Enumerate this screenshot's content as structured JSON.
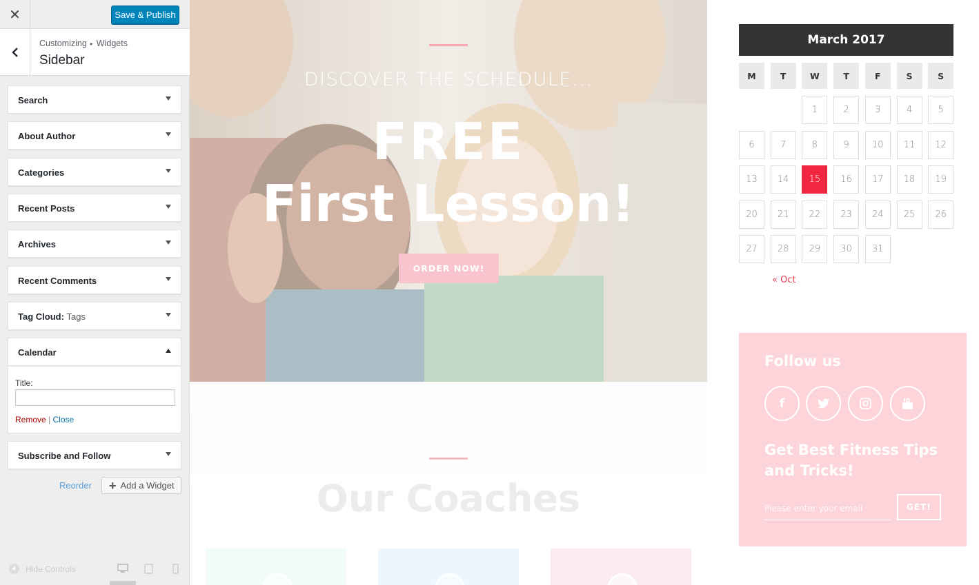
{
  "customizer": {
    "close_icon": "close-icon",
    "publish_label": "Save & Publish",
    "breadcrumb": {
      "root": "Customizing",
      "separator": "▸",
      "current": "Widgets"
    },
    "section_title": "Sidebar",
    "widgets": [
      {
        "title": "Search",
        "sub": ""
      },
      {
        "title": "About Author",
        "sub": ""
      },
      {
        "title": "Categories",
        "sub": ""
      },
      {
        "title": "Recent Posts",
        "sub": ""
      },
      {
        "title": "Archives",
        "sub": ""
      },
      {
        "title": "Recent Comments",
        "sub": ""
      },
      {
        "title": "Tag Cloud:",
        "sub": "Tags"
      },
      {
        "title": "Calendar",
        "sub": ""
      },
      {
        "title": "Subscribe and Follow",
        "sub": ""
      }
    ],
    "calendar_widget": {
      "title_label": "Title:",
      "title_value": "",
      "remove_label": "Remove",
      "separator": "|",
      "close_label": "Close"
    },
    "reorder_label": "Reorder",
    "add_widget_label": "Add a Widget",
    "hide_controls_label": "Hide Controls"
  },
  "preview": {
    "hero": {
      "subtitle": "DISCOVER THE SCHEDULE...",
      "title_line1": "FREE",
      "title_line2": "First Lesson!",
      "button_label": "ORDER NOW!"
    },
    "coaches_title": "Our Coaches",
    "calendar": {
      "caption": "March 2017",
      "weekdays": [
        "M",
        "T",
        "W",
        "T",
        "F",
        "S",
        "S"
      ],
      "days": [
        "1",
        "2",
        "3",
        "4",
        "5",
        "6",
        "7",
        "8",
        "9",
        "10",
        "11",
        "12",
        "13",
        "14",
        "15",
        "16",
        "17",
        "18",
        "19",
        "20",
        "21",
        "22",
        "23",
        "24",
        "25",
        "26",
        "27",
        "28",
        "29",
        "30",
        "31"
      ],
      "first_weekday_index": 2,
      "today": "15",
      "prev_link": "« Oct"
    },
    "follow": {
      "title": "Follow us",
      "socials": [
        "facebook-icon",
        "twitter-icon",
        "instagram-icon",
        "youtube-icon"
      ],
      "tips_title": "Get Best Fitness Tips and Tricks!",
      "email_placeholder": "Please enter your email",
      "button_label": "GET!"
    }
  },
  "colors": {
    "publish_blue": "#0085ba",
    "today_red": "#f0273f",
    "follow_pink": "#fdd4da",
    "calendar_header": "#333333"
  }
}
